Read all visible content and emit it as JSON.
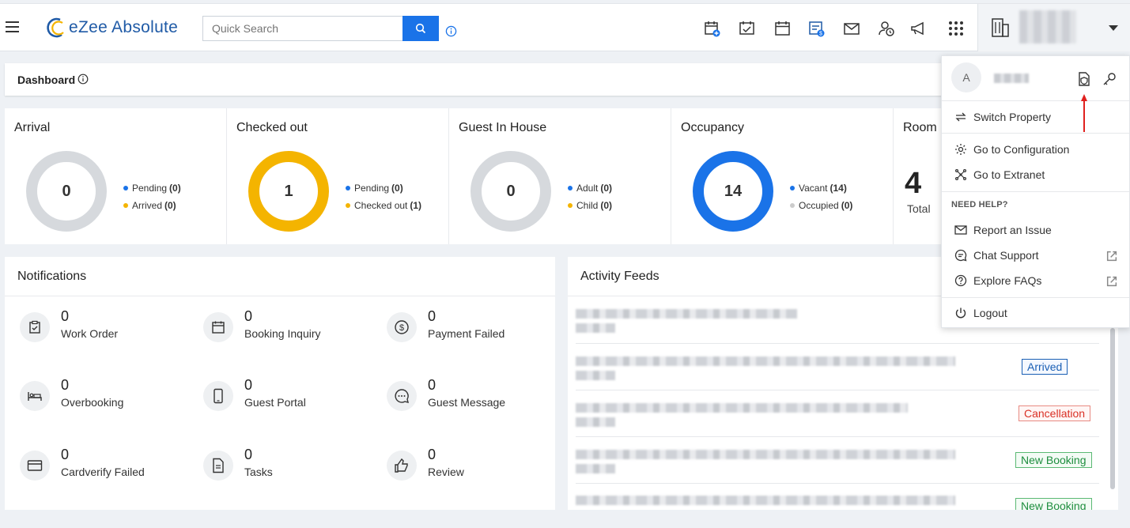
{
  "topbar": {
    "app_name": "eZee Absolute",
    "search_placeholder": "Quick Search"
  },
  "dashboard": {
    "title": "Dashboard"
  },
  "stats": [
    {
      "title": "Arrival",
      "value": "0",
      "legend": [
        {
          "label": "Pending",
          "count": "(0)",
          "color": "#1a73e8"
        },
        {
          "label": "Arrived",
          "count": "(0)",
          "color": "#f4b400"
        }
      ]
    },
    {
      "title": "Checked out",
      "value": "1",
      "legend": [
        {
          "label": "Pending",
          "count": "(0)",
          "color": "#1a73e8"
        },
        {
          "label": "Checked out",
          "count": "(1)",
          "color": "#f4b400"
        }
      ]
    },
    {
      "title": "Guest In House",
      "value": "0",
      "legend": [
        {
          "label": "Adult",
          "count": "(0)",
          "color": "#1a73e8"
        },
        {
          "label": "Child",
          "count": "(0)",
          "color": "#f4b400"
        }
      ]
    },
    {
      "title": "Occupancy",
      "value": "14",
      "legend": [
        {
          "label": "Vacant",
          "count": "(14)",
          "color": "#1a73e8"
        },
        {
          "label": "Occupied",
          "count": "(0)",
          "color": "#cccccc"
        }
      ]
    },
    {
      "title": "Room",
      "value": "4",
      "sub": "Total"
    }
  ],
  "colors": {
    "accent": "#1a73e8",
    "yellow": "#f4b400",
    "grey_ring": "#d6d9dd",
    "green": "#1e8e3e",
    "red": "#d93025"
  },
  "notifications": {
    "title": "Notifications",
    "items": [
      {
        "count": "0",
        "label": "Work Order",
        "icon": "clipboard-check-icon"
      },
      {
        "count": "0",
        "label": "Booking Inquiry",
        "icon": "calendar-icon"
      },
      {
        "count": "0",
        "label": "Payment Failed",
        "icon": "dollar-icon"
      },
      {
        "count": "0",
        "label": "Overbooking",
        "icon": "bed-icon"
      },
      {
        "count": "0",
        "label": "Guest Portal",
        "icon": "mobile-icon"
      },
      {
        "count": "0",
        "label": "Guest Message",
        "icon": "chat-icon"
      },
      {
        "count": "0",
        "label": "Cardverify Failed",
        "icon": "credit-card-icon"
      },
      {
        "count": "0",
        "label": "Tasks",
        "icon": "document-icon"
      },
      {
        "count": "0",
        "label": "Review",
        "icon": "thumbs-up-icon"
      }
    ]
  },
  "activity": {
    "title": "Activity Feeds",
    "badges": [
      "Arrived",
      "Cancellation",
      "New Booking",
      "New Booking"
    ]
  },
  "menu": {
    "avatar_letter": "A",
    "switch_property": "Switch Property",
    "go_config": "Go to Configuration",
    "go_extranet": "Go to Extranet",
    "need_help": "NEED HELP?",
    "report_issue": "Report an Issue",
    "chat_support": "Chat Support",
    "explore_faqs": "Explore FAQs",
    "logout": "Logout"
  }
}
